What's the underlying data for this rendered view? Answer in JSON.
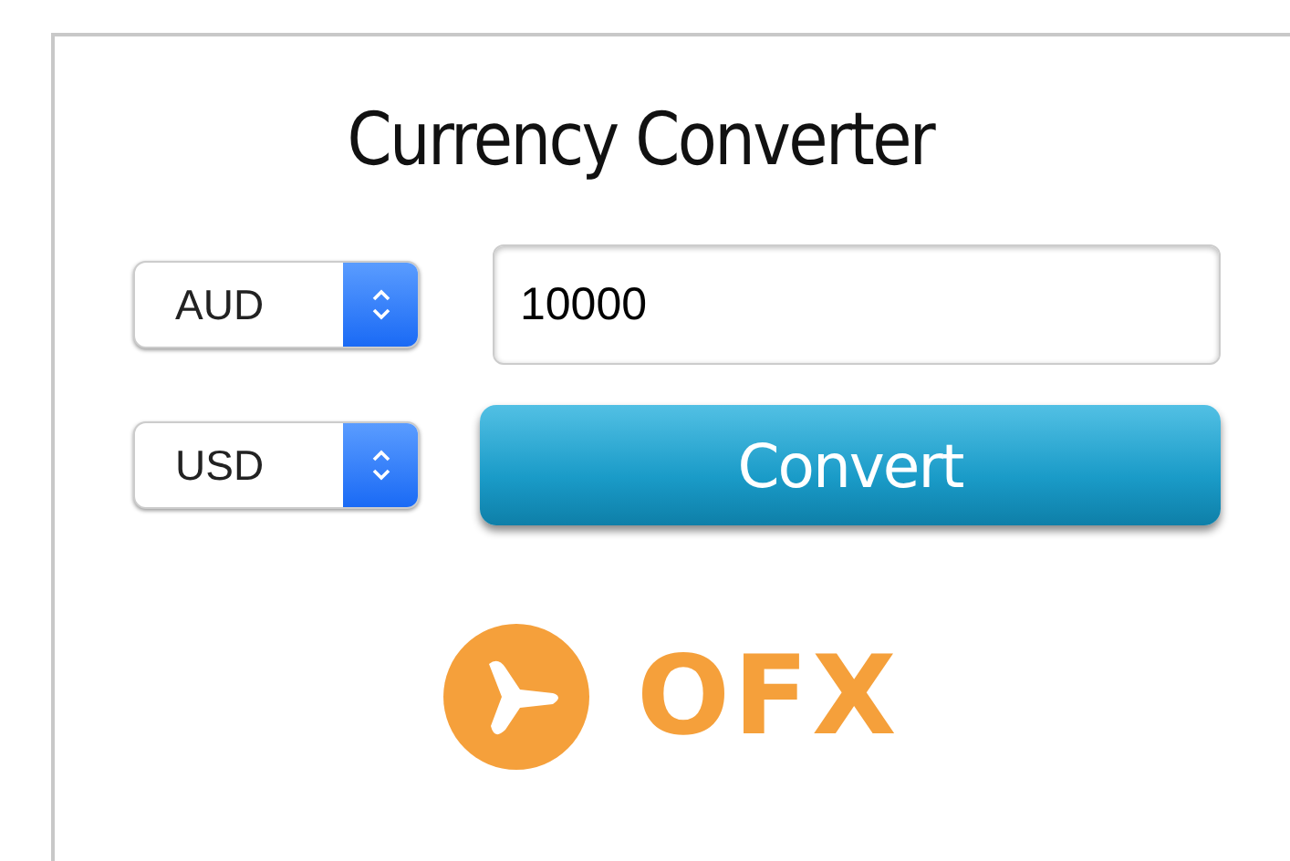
{
  "title": "Currency Converter",
  "from_currency": {
    "value": "AUD"
  },
  "amount": {
    "value": "10000"
  },
  "to_currency": {
    "value": "USD"
  },
  "convert_button": {
    "label": "Convert"
  },
  "logo": {
    "text": "OFX"
  }
}
